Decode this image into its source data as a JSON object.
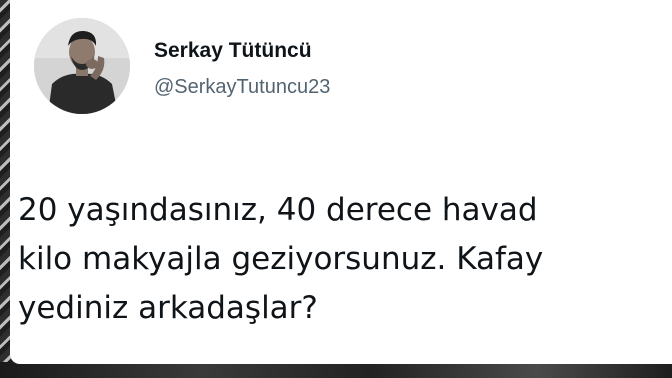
{
  "tweet": {
    "author": {
      "display_name": "Serkay Tütüncü",
      "handle": "@SerkayTutuncu23",
      "avatar_icon": "profile-photo"
    },
    "text_lines": [
      "20 yaşındasınız, 40 derece havad",
      "kilo makyajla geziyorsunuz. Kafay",
      "yediniz arkadaşlar?"
    ]
  }
}
